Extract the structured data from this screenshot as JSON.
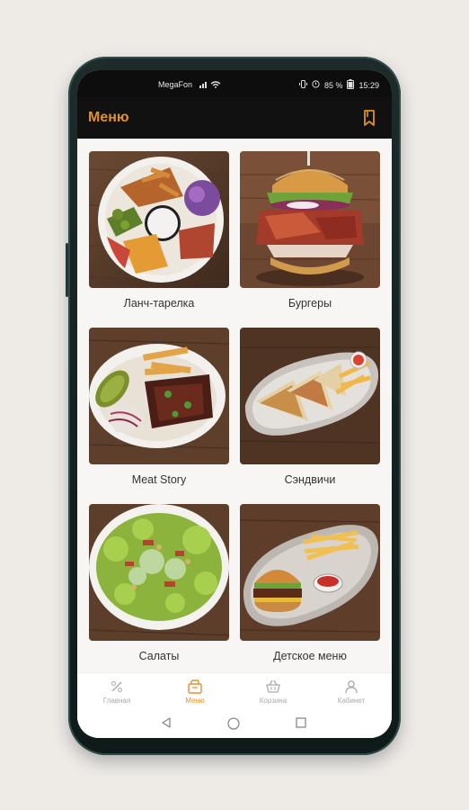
{
  "status": {
    "carrier": "MegaFon",
    "battery": "85 %",
    "time": "15:29"
  },
  "header": {
    "title": "Меню"
  },
  "menu": {
    "categories": [
      {
        "label": "Ланч-тарелка"
      },
      {
        "label": "Бургеры"
      },
      {
        "label": "Meat Story"
      },
      {
        "label": "Сэндвичи"
      },
      {
        "label": "Салаты"
      },
      {
        "label": "Детское меню"
      }
    ]
  },
  "tabs": [
    {
      "label": "Главная",
      "icon": "percent-icon"
    },
    {
      "label": "Меню",
      "icon": "menu-bag-icon",
      "active": true
    },
    {
      "label": "Корзина",
      "icon": "basket-icon"
    },
    {
      "label": "Кабинет",
      "icon": "user-icon"
    }
  ],
  "colors": {
    "accent": "#e0912c",
    "appbar": "#111111",
    "background": "#eeebe7"
  }
}
